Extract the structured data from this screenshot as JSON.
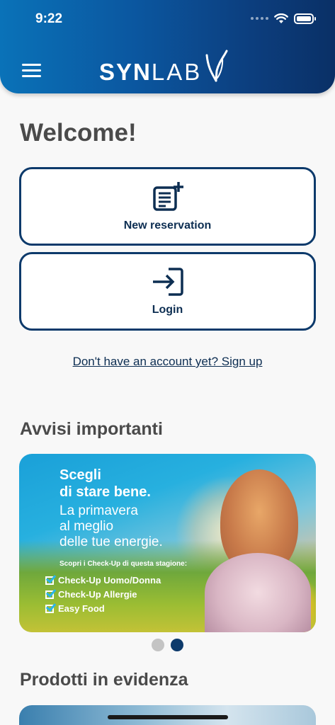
{
  "status_bar": {
    "time": "9:22"
  },
  "header": {
    "logo_bold": "SYN",
    "logo_light": "LAB"
  },
  "welcome": "Welcome!",
  "actions": {
    "new_reservation": "New reservation",
    "login": "Login"
  },
  "signup_link": "Don't have an account yet? Sign up",
  "sections": {
    "avvisi": "Avvisi importanti",
    "prodotti": "Prodotti in evidenza"
  },
  "banner": {
    "headline_1": "Scegli",
    "headline_2": "di stare bene.",
    "sub_1": "La primavera",
    "sub_2": "al meglio",
    "sub_3": "delle tue energie.",
    "small": "Scopri i Check-Up di questa stagione:",
    "items": [
      "Check-Up Uomo/Donna",
      "Check-Up Allergie",
      "Easy Food"
    ]
  },
  "carousel": {
    "count": 2,
    "active_index": 1
  },
  "colors": {
    "brand_dark": "#0d3a6b",
    "header_start": "#0a72b8",
    "header_end": "#0a3066",
    "dot_inactive": "#c4c4c4",
    "dot_active": "#0d3a6b"
  }
}
